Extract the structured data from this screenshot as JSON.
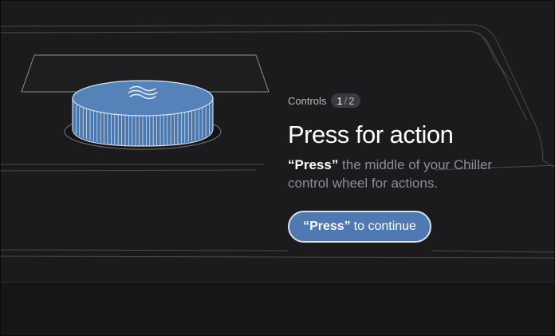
{
  "header": {
    "section_label": "Controls",
    "page_current": "1",
    "page_separator": "/",
    "page_total": "2"
  },
  "main": {
    "title": "Press for action",
    "description_highlight": "“Press”",
    "description_rest": " the middle of your Chiller control wheel for actions."
  },
  "button": {
    "strong_text": "“Press”",
    "rest_text": "to continue"
  },
  "illustration": {
    "knob_icon": "chiller-wave-logo-icon"
  },
  "colors": {
    "background": "#1b1b1d",
    "accent": "#4f79b0",
    "knob_fill": "#4b77ad"
  }
}
